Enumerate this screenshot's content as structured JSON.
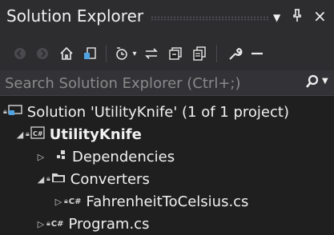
{
  "window": {
    "title": "Solution Explorer",
    "dropdown_icon": "chevron-down-icon",
    "pin_icon": "pin-icon",
    "close_icon": "close-icon"
  },
  "toolbar": {
    "icons": [
      "back-icon",
      "forward-icon",
      "home-icon",
      "switch-views-icon",
      "pending-changes-filter-icon",
      "sync-active-document-icon",
      "collapse-all-icon",
      "show-all-files-icon",
      "properties-icon",
      "preview-icon"
    ]
  },
  "search": {
    "placeholder": "Search Solution Explorer (Ctrl+;)"
  },
  "tree": {
    "solution": "Solution 'UtilityKnife' (1 of 1 project)",
    "project": "UtilityKnife",
    "dependencies": "Dependencies",
    "folder": "Converters",
    "file1": "FahrenheitToCelsius.cs",
    "file2": "Program.cs",
    "csharp_badge": "C#"
  },
  "colors": {
    "accent_blue": "#4fa3e0",
    "folder_fill": "#d8d8d8",
    "csharp_project": "#68217a"
  }
}
